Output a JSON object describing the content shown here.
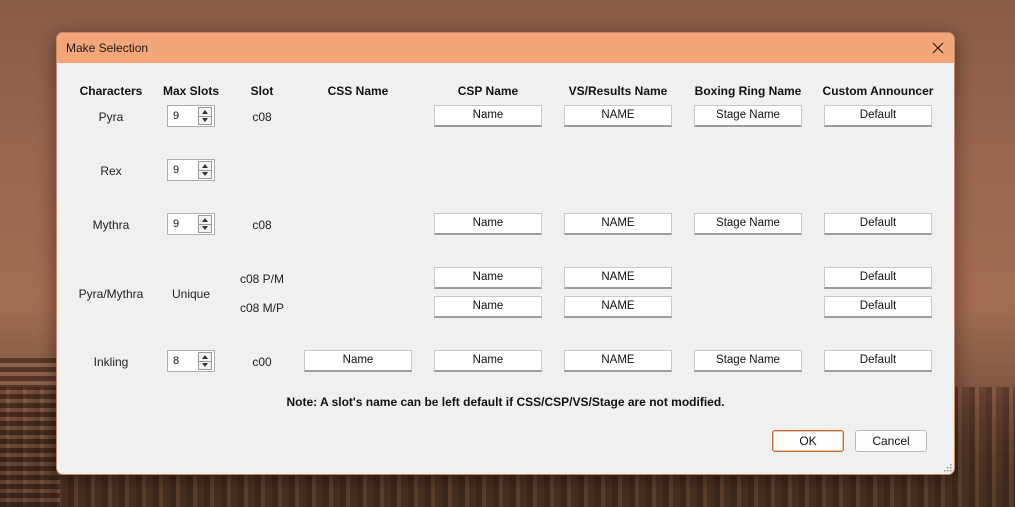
{
  "dialog": {
    "title": "Make Selection",
    "headers": {
      "characters": "Characters",
      "max_slots": "Max Slots",
      "slot": "Slot",
      "css_name": "CSS Name",
      "csp_name": "CSP Name",
      "vs_results_name": "VS/Results Name",
      "boxing_ring_name": "Boxing Ring Name",
      "custom_announcer": "Custom Announcer"
    },
    "rows": {
      "pyra": {
        "name": "Pyra",
        "max_slots": "9",
        "slot": "c08",
        "csp": "Name",
        "vs": "NAME",
        "stage": "Stage Name",
        "announcer": "Default"
      },
      "rex": {
        "name": "Rex",
        "max_slots": "9"
      },
      "mythra": {
        "name": "Mythra",
        "max_slots": "9",
        "slot": "c08",
        "csp": "Name",
        "vs": "NAME",
        "stage": "Stage Name",
        "announcer": "Default"
      },
      "pyra_mythra": {
        "name": "Pyra/Mythra",
        "max_slots": "Unique",
        "slot_pm": "c08 P/M",
        "csp_pm": "Name",
        "vs_pm": "NAME",
        "announcer_pm": "Default",
        "slot_mp": "c08 M/P",
        "csp_mp": "Name",
        "vs_mp": "NAME",
        "announcer_mp": "Default"
      },
      "inkling": {
        "name": "Inkling",
        "max_slots": "8",
        "slot": "c00",
        "css": "Name",
        "csp": "Name",
        "vs": "NAME",
        "stage": "Stage Name",
        "announcer": "Default"
      }
    },
    "note": "Note: A slot's name can be left default if CSS/CSP/VS/Stage are not modified.",
    "ok_label": "OK",
    "cancel_label": "Cancel"
  },
  "icons": {
    "close": "close-icon",
    "spin_up": "chevron-up-icon",
    "spin_down": "chevron-down-icon",
    "resize": "resize-grip-icon"
  },
  "colors": {
    "titlebar": "#f4a57a",
    "dialog_bg": "#f0f0f0",
    "ok_border": "#c46a36"
  }
}
